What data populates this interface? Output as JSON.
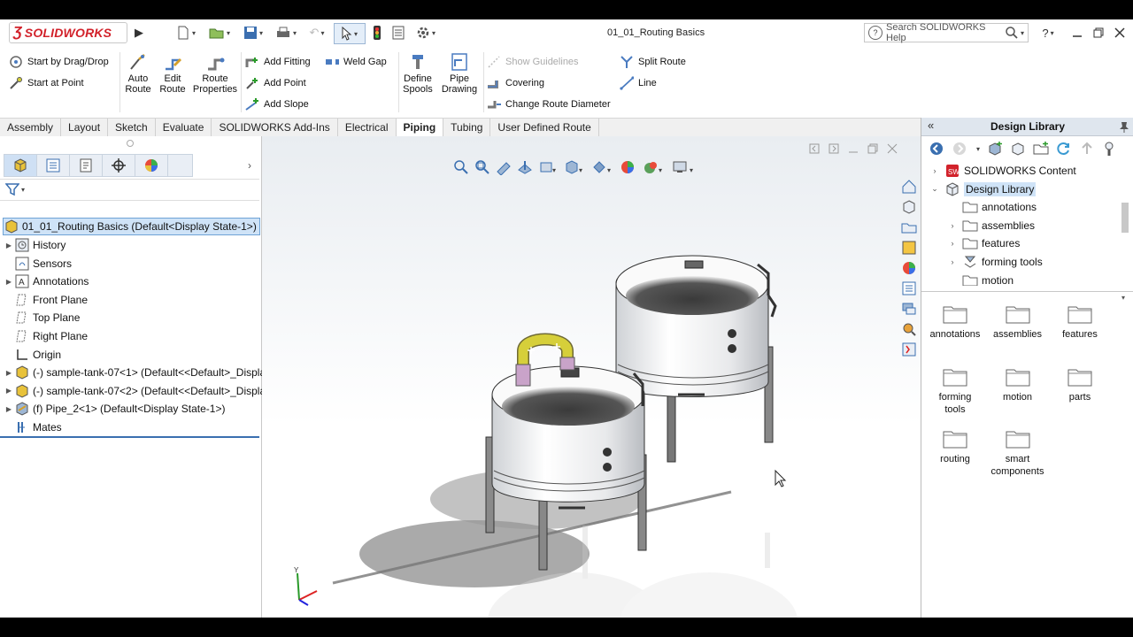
{
  "app": {
    "brand": "SOLIDWORKS",
    "document_title": "01_01_Routing Basics",
    "search_placeholder": "Search SOLIDWORKS Help"
  },
  "command_manager": {
    "start_by_drag_drop": "Start by Drag/Drop",
    "start_at_point": "Start at Point",
    "auto_route": [
      "Auto",
      "Route"
    ],
    "edit_route": [
      "Edit",
      "Route"
    ],
    "route_properties": [
      "Route",
      "Properties"
    ],
    "add_fitting": "Add Fitting",
    "add_point": "Add Point",
    "add_slope": "Add Slope",
    "weld_gap": "Weld Gap",
    "define_spools": [
      "Define",
      "Spools"
    ],
    "pipe_drawing": [
      "Pipe",
      "Drawing"
    ],
    "show_guidelines": "Show Guidelines",
    "covering": "Covering",
    "change_route_diameter": "Change Route Diameter",
    "split_route": "Split Route",
    "line": "Line"
  },
  "tabs": [
    "Assembly",
    "Layout",
    "Sketch",
    "Evaluate",
    "SOLIDWORKS Add-Ins",
    "Electrical",
    "Piping",
    "Tubing",
    "User Defined Route"
  ],
  "active_tab": "Piping",
  "feature_tree": {
    "root": "01_01_Routing Basics  (Default<Display State-1>)",
    "items": [
      {
        "label": "History",
        "expandable": true,
        "icon": "history-icon"
      },
      {
        "label": "Sensors",
        "expandable": false,
        "icon": "sensors-icon"
      },
      {
        "label": "Annotations",
        "expandable": true,
        "icon": "annotations-icon"
      },
      {
        "label": "Front Plane",
        "expandable": false,
        "icon": "plane-icon"
      },
      {
        "label": "Top Plane",
        "expandable": false,
        "icon": "plane-icon"
      },
      {
        "label": "Right Plane",
        "expandable": false,
        "icon": "plane-icon"
      },
      {
        "label": "Origin",
        "expandable": false,
        "icon": "origin-icon"
      },
      {
        "label": "(-) sample-tank-07<1> (Default<<Default>_Displa",
        "expandable": true,
        "icon": "part-icon"
      },
      {
        "label": "(-) sample-tank-07<2> (Default<<Default>_Displa",
        "expandable": true,
        "icon": "part-icon"
      },
      {
        "label": "(f) Pipe_2<1> (Default<Display State-1>)",
        "expandable": true,
        "icon": "route-assembly-icon"
      },
      {
        "label": "Mates",
        "expandable": false,
        "icon": "mates-icon"
      }
    ]
  },
  "design_library": {
    "title": "Design Library",
    "tree": [
      {
        "label": "SOLIDWORKS Content",
        "level": 0,
        "expanded": false
      },
      {
        "label": "Design Library",
        "level": 0,
        "expanded": true,
        "selected": true
      },
      {
        "label": "annotations",
        "level": 1,
        "expanded": null
      },
      {
        "label": "assemblies",
        "level": 1,
        "expanded": false
      },
      {
        "label": "features",
        "level": 1,
        "expanded": false
      },
      {
        "label": "forming tools",
        "level": 1,
        "expanded": false
      },
      {
        "label": "motion",
        "level": 1,
        "expanded": null
      }
    ],
    "folders": [
      [
        "annotations"
      ],
      [
        "assemblies"
      ],
      [
        "features"
      ],
      [
        "forming",
        "tools"
      ],
      [
        "motion"
      ],
      [
        "parts"
      ],
      [
        "routing"
      ],
      [
        "smart",
        "components"
      ]
    ]
  },
  "triad": {
    "y_label": "Y"
  },
  "colors": {
    "brand_red": "#d2222b",
    "selection_blue": "#cfe3f7",
    "pipe_yellow": "#d6cf3a"
  }
}
